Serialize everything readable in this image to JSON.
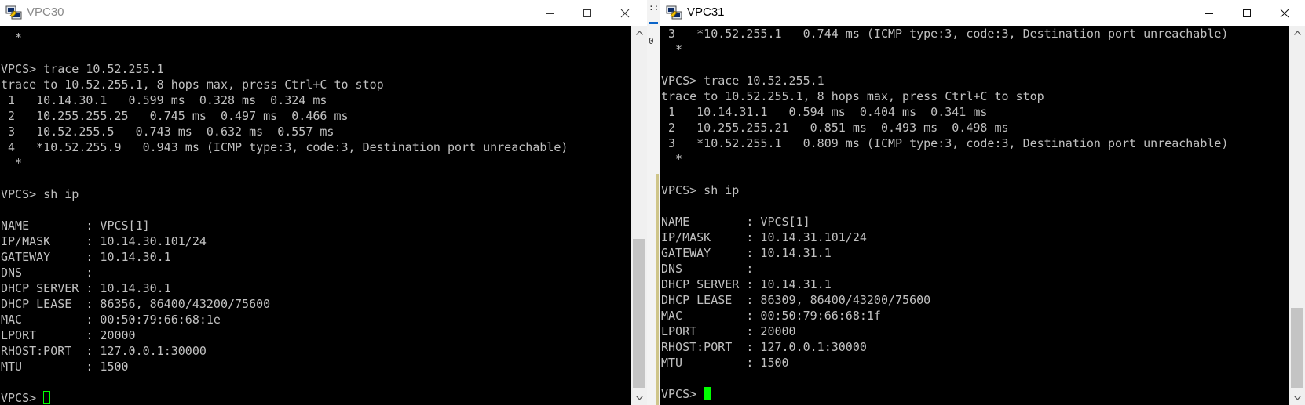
{
  "windows": {
    "left": {
      "title": "VPC30",
      "terminal_text": "  *\n\nVPCS> trace 10.52.255.1\ntrace to 10.52.255.1, 8 hops max, press Ctrl+C to stop\n 1   10.14.30.1   0.599 ms  0.328 ms  0.324 ms\n 2   10.255.255.25   0.745 ms  0.497 ms  0.466 ms\n 3   10.52.255.5   0.743 ms  0.632 ms  0.557 ms\n 4   *10.52.255.9   0.943 ms (ICMP type:3, code:3, Destination port unreachable)\n  *\n\nVPCS> sh ip\n\nNAME        : VPCS[1]\nIP/MASK     : 10.14.30.101/24\nGATEWAY     : 10.14.30.1\nDNS         :\nDHCP SERVER : 10.14.30.1\nDHCP LEASE  : 86356, 86400/43200/75600\nMAC         : 00:50:79:66:68:1e\nLPORT       : 20000\nRHOST:PORT  : 127.0.0.1:30000\nMTU         : 1500\n\n",
      "prompt": "VPCS> "
    },
    "right": {
      "title": "VPC31",
      "terminal_text": " 3   *10.52.255.1   0.744 ms (ICMP type:3, code:3, Destination port unreachable)\n  *\n\nVPCS> trace 10.52.255.1\ntrace to 10.52.255.1, 8 hops max, press Ctrl+C to stop\n 1   10.14.31.1   0.594 ms  0.404 ms  0.341 ms\n 2   10.255.255.21   0.851 ms  0.493 ms  0.498 ms\n 3   *10.52.255.1   0.809 ms (ICMP type:3, code:3, Destination port unreachable)\n  *\n\nVPCS> sh ip\n\nNAME        : VPCS[1]\nIP/MASK     : 10.14.31.101/24\nGATEWAY     : 10.14.31.1\nDNS         :\nDHCP SERVER : 10.14.31.1\nDHCP LEASE  : 86309, 86400/43200/75600\nMAC         : 00:50:79:66:68:1f\nLPORT       : 20000\nRHOST:PORT  : 127.0.0.1:30000\nMTU         : 1500\n\n",
      "prompt": "VPCS> "
    }
  },
  "gap": {
    "top_mark": "::",
    "mark": "0"
  },
  "colors": {
    "terminal_bg": "#000000",
    "terminal_fg": "#c0c0c0",
    "cursor": "#00ff00"
  },
  "icons": {
    "app": "putty-icon",
    "minimize": "minimize-icon",
    "maximize": "maximize-icon",
    "close": "close-icon"
  }
}
